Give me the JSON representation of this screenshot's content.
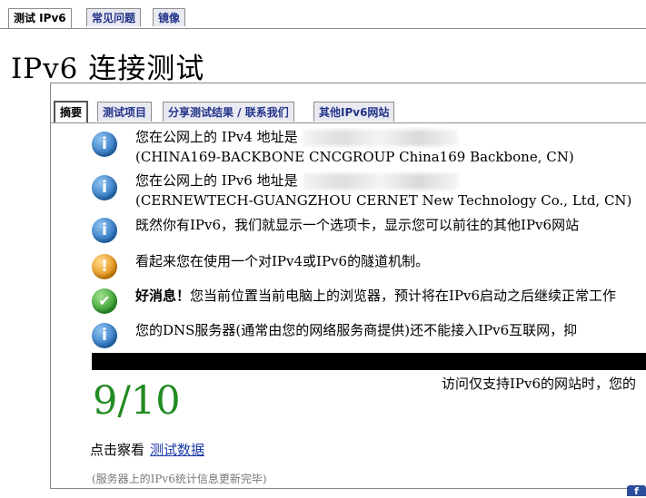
{
  "top_tabs": [
    "测试 IPv6",
    "常见问题",
    "镜像"
  ],
  "page_title": "IPv6 连接测试",
  "inner_tabs": [
    "摘要",
    "测试项目",
    "分享测试结果 / 联系我们",
    "其他IPv6网站"
  ],
  "results": [
    {
      "icon": "info-icon",
      "line1": "您在公网上的 IPv4 地址是",
      "line2": "(CHINA169-BACKBONE CNCGROUP China169 Backbone, CN)"
    },
    {
      "icon": "info-icon",
      "line1": "您在公网上的 IPv6 地址是",
      "line2": "(CERNEWTECH-GUANGZHOU CERNET New Technology Co., Ltd, CN)"
    },
    {
      "icon": "info-icon",
      "line1": "既然你有IPv6，我们就显示一个选项卡，显示您可以前往的其他IPv6网站"
    },
    {
      "icon": "warning-icon",
      "line1": "看起来您在使用一个对IPv4或IPv6的隧道机制。"
    },
    {
      "icon": "check-icon",
      "bold": "好消息！",
      "line1": "您当前位置当前电脑上的浏览器，预计将在IPv6启动之后继续正常工作"
    },
    {
      "icon": "info-icon",
      "line1": "您的DNS服务器(通常由您的网络服务商提供)还不能接入IPv6互联网，抑"
    }
  ],
  "score": "9/10",
  "score_note": "访问仅支持IPv6的网站时，您的",
  "click_text": "点击察看",
  "click_link": "测试数据",
  "update_note": "(服务器上的IPv6统计信息更新完毕)",
  "colors": {
    "score": "#228b22",
    "link": "#1a3aa8",
    "tab_bg": "#e9e9f2"
  }
}
